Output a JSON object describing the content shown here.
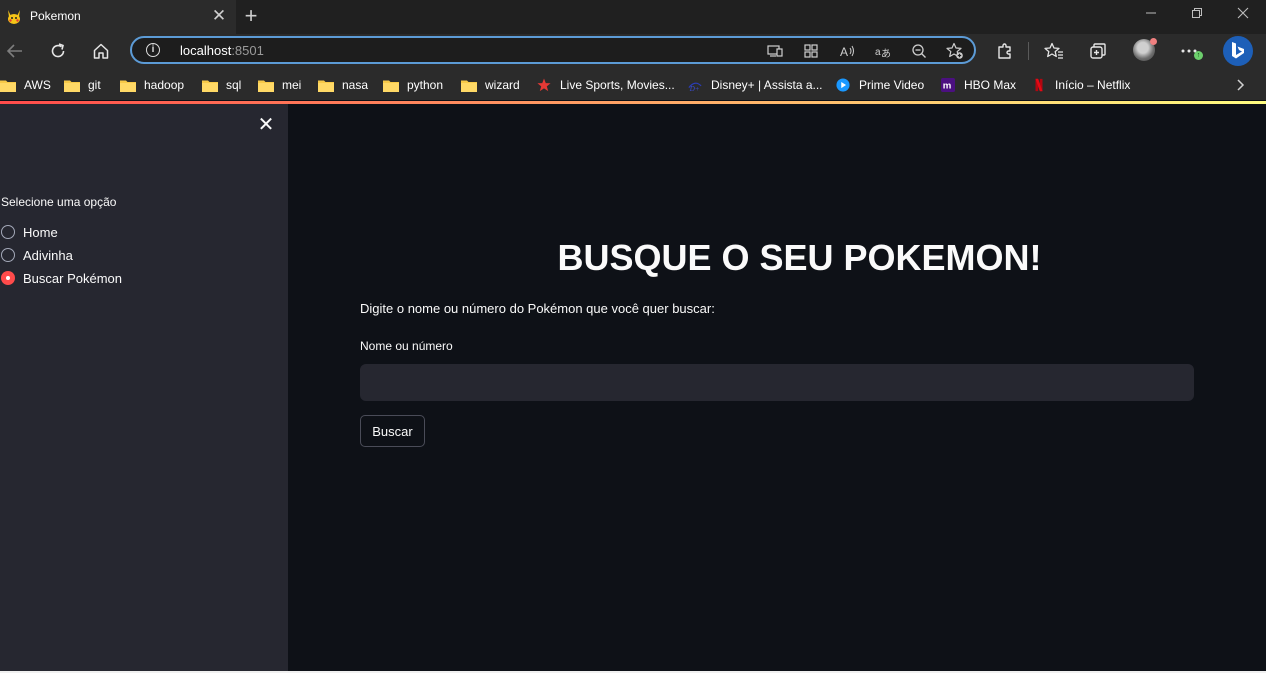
{
  "browser": {
    "tab_title": "Pokemon",
    "url_host": "localhost",
    "url_port": ":8501",
    "bookmarks": [
      {
        "label": "AWS",
        "icon": "folder-icon"
      },
      {
        "label": "git",
        "icon": "folder-icon"
      },
      {
        "label": "hadoop",
        "icon": "folder-icon"
      },
      {
        "label": "sql",
        "icon": "folder-icon"
      },
      {
        "label": "mei",
        "icon": "folder-icon"
      },
      {
        "label": "nasa",
        "icon": "folder-icon"
      },
      {
        "label": "python",
        "icon": "folder-icon"
      },
      {
        "label": "wizard",
        "icon": "folder-icon"
      },
      {
        "label": "Live Sports, Movies...",
        "icon": "star-icon"
      },
      {
        "label": "Disney+ | Assista a...",
        "icon": "disney-icon"
      },
      {
        "label": "Prime Video",
        "icon": "prime-video-icon"
      },
      {
        "label": "HBO Max",
        "icon": "hbo-max-icon"
      },
      {
        "label": "Início – Netflix",
        "icon": "netflix-icon"
      }
    ],
    "accent_colors": {
      "primary": "#ff4b4b",
      "address_border": "#5c9bd6"
    }
  },
  "sidebar": {
    "radio_heading": "Selecione uma opção",
    "options": [
      {
        "label": "Home",
        "selected": false
      },
      {
        "label": "Adivinha",
        "selected": false
      },
      {
        "label": "Buscar Pokémon",
        "selected": true
      }
    ]
  },
  "main": {
    "title": "BUSQUE O SEU POKEMON!",
    "description": "Digite o nome ou número do Pokémon que você quer buscar:",
    "input_label": "Nome ou número",
    "input_value": "",
    "button_label": "Buscar"
  }
}
